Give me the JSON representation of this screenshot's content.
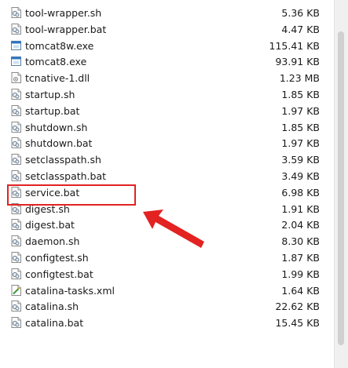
{
  "files": [
    {
      "name": "tool-wrapper.sh",
      "size": "5.36 KB",
      "icon": "script-file-icon"
    },
    {
      "name": "tool-wrapper.bat",
      "size": "4.47 KB",
      "icon": "script-file-icon"
    },
    {
      "name": "tomcat8w.exe",
      "size": "115.41 KB",
      "icon": "exe-file-icon"
    },
    {
      "name": "tomcat8.exe",
      "size": "93.91 KB",
      "icon": "exe-file-icon"
    },
    {
      "name": "tcnative-1.dll",
      "size": "1.23 MB",
      "icon": "dll-file-icon"
    },
    {
      "name": "startup.sh",
      "size": "1.85 KB",
      "icon": "script-file-icon"
    },
    {
      "name": "startup.bat",
      "size": "1.97 KB",
      "icon": "script-file-icon"
    },
    {
      "name": "shutdown.sh",
      "size": "1.85 KB",
      "icon": "script-file-icon"
    },
    {
      "name": "shutdown.bat",
      "size": "1.97 KB",
      "icon": "script-file-icon"
    },
    {
      "name": "setclasspath.sh",
      "size": "3.59 KB",
      "icon": "script-file-icon"
    },
    {
      "name": "setclasspath.bat",
      "size": "3.49 KB",
      "icon": "script-file-icon"
    },
    {
      "name": "service.bat",
      "size": "6.98 KB",
      "icon": "script-file-icon"
    },
    {
      "name": "digest.sh",
      "size": "1.91 KB",
      "icon": "script-file-icon"
    },
    {
      "name": "digest.bat",
      "size": "2.04 KB",
      "icon": "script-file-icon"
    },
    {
      "name": "daemon.sh",
      "size": "8.30 KB",
      "icon": "script-file-icon"
    },
    {
      "name": "configtest.sh",
      "size": "1.87 KB",
      "icon": "script-file-icon"
    },
    {
      "name": "configtest.bat",
      "size": "1.99 KB",
      "icon": "script-file-icon"
    },
    {
      "name": "catalina-tasks.xml",
      "size": "1.64 KB",
      "icon": "xml-file-icon"
    },
    {
      "name": "catalina.sh",
      "size": "22.62 KB",
      "icon": "script-file-icon"
    },
    {
      "name": "catalina.bat",
      "size": "15.45 KB",
      "icon": "script-file-icon"
    }
  ],
  "highlighted_file": "service.bat",
  "annotation_color": "#e32222"
}
